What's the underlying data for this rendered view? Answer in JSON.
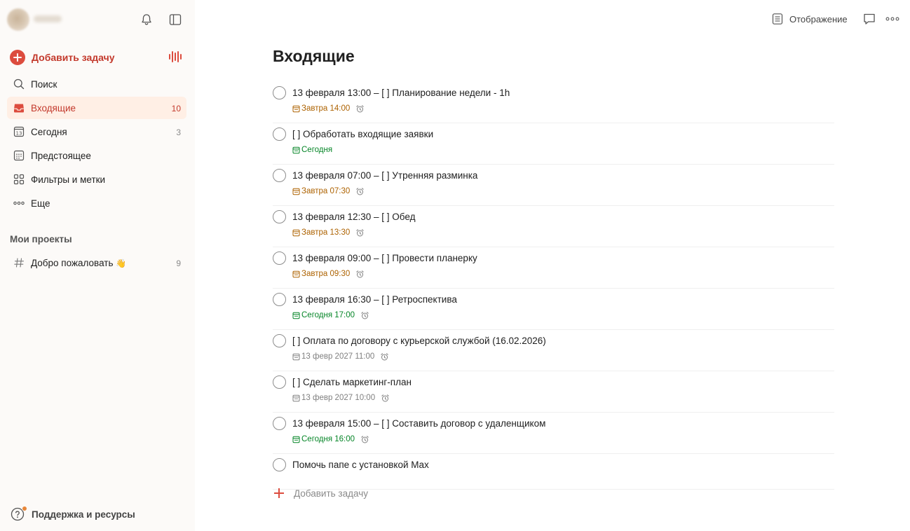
{
  "colors": {
    "accent": "#dc4c3e",
    "tomorrow": "#ad6200",
    "today": "#058527",
    "future": "#808080"
  },
  "sidebar": {
    "add_task_label": "Добавить задачу",
    "nav": [
      {
        "label": "Поиск",
        "count": "",
        "icon": "search-icon",
        "active": false
      },
      {
        "label": "Входящие",
        "count": "10",
        "icon": "inbox-icon",
        "active": true
      },
      {
        "label": "Сегодня",
        "count": "3",
        "icon": "today-calendar-icon",
        "active": false
      },
      {
        "label": "Предстоящее",
        "count": "",
        "icon": "upcoming-calendar-icon",
        "active": false
      },
      {
        "label": "Фильтры и метки",
        "count": "",
        "icon": "filters-grid-icon",
        "active": false
      },
      {
        "label": "Еще",
        "count": "",
        "icon": "more-dots-icon",
        "active": false
      }
    ],
    "projects_title": "Мои проекты",
    "projects": [
      {
        "label": "Добро пожаловать",
        "count": "9",
        "icon": "hash-icon",
        "emoji": "👋"
      }
    ],
    "support_label": "Поддержка и ресурсы"
  },
  "header": {
    "view_label": "Отображение"
  },
  "main": {
    "title": "Входящие",
    "tasks": [
      {
        "title": "13 февраля 13:00 – [ ] Планирование недели - 1h",
        "date": "Завтра 14:00",
        "date_kind": "tomorrow",
        "alarm": true
      },
      {
        "title": "[ ] Обработать входящие заявки",
        "date": "Сегодня",
        "date_kind": "today",
        "alarm": false
      },
      {
        "title": "13 февраля 07:00 – [ ] Утренняя разминка",
        "date": "Завтра 07:30",
        "date_kind": "tomorrow",
        "alarm": true
      },
      {
        "title": "13 февраля 12:30 – [ ] Обед",
        "date": "Завтра 13:30",
        "date_kind": "tomorrow",
        "alarm": true
      },
      {
        "title": "13 февраля 09:00 – [ ] Провести планерку",
        "date": "Завтра 09:30",
        "date_kind": "tomorrow",
        "alarm": true
      },
      {
        "title": "13 февраля 16:30 – [ ] Ретроспектива",
        "date": "Сегодня 17:00",
        "date_kind": "today",
        "alarm": true
      },
      {
        "title": "[ ] Оплата по договору с курьерской службой (16.02.2026)",
        "date": "13 февр 2027 11:00",
        "date_kind": "future",
        "alarm": true
      },
      {
        "title": "[ ] Сделать маркетинг-план",
        "date": "13 февр 2027 10:00",
        "date_kind": "future",
        "alarm": true
      },
      {
        "title": "13 февраля 15:00 – [ ] Составить договор с удаленщиком",
        "date": "Сегодня 16:00",
        "date_kind": "today",
        "alarm": true
      },
      {
        "title": "Помочь папе с установкой Max",
        "date": "",
        "date_kind": "none",
        "alarm": false
      }
    ],
    "add_task_label": "Добавить задачу"
  }
}
